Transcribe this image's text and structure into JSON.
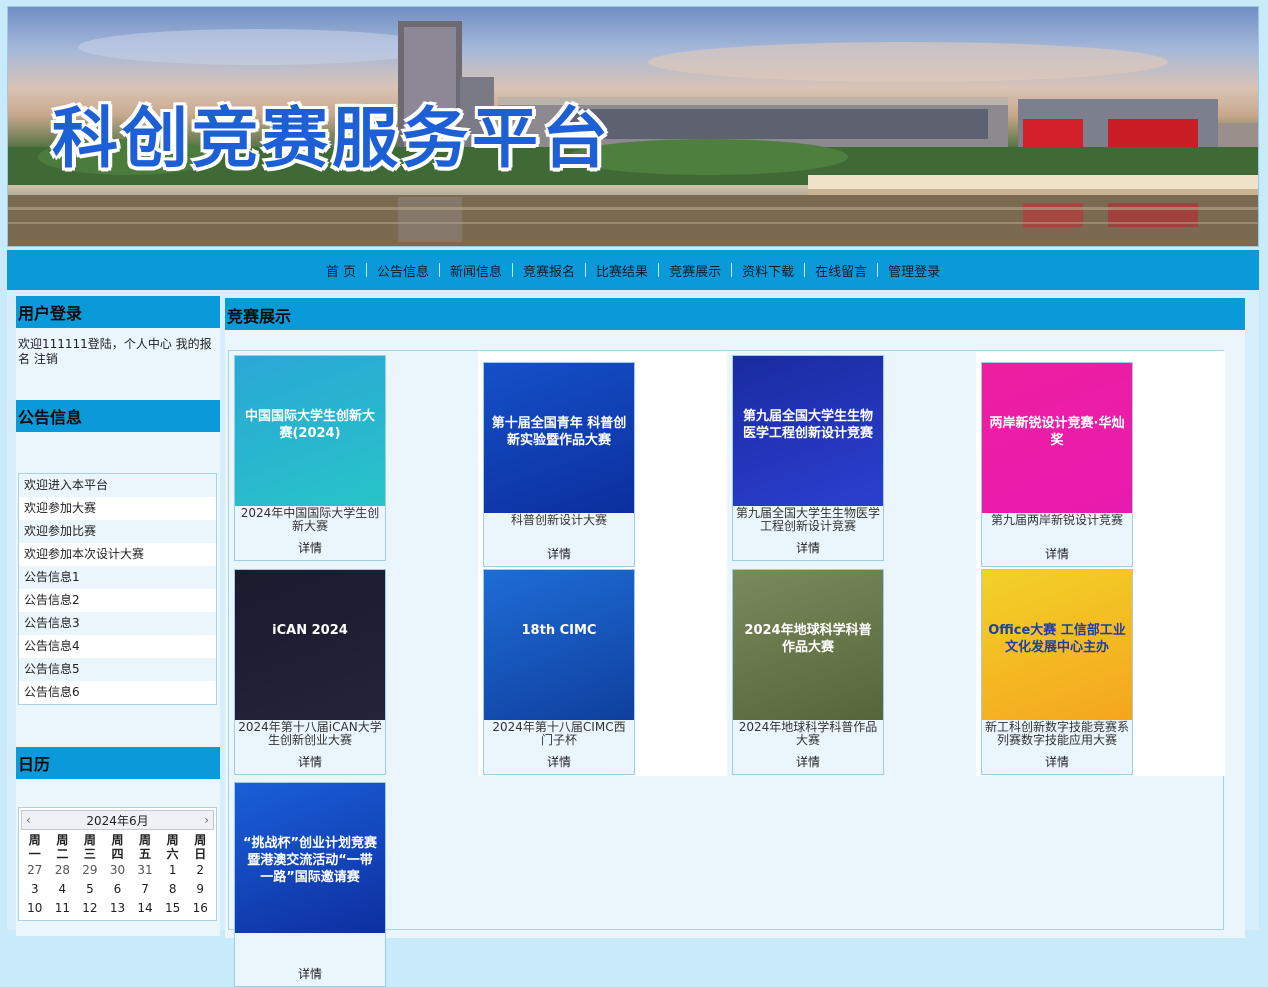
{
  "banner": {
    "title": "科创竞赛服务平台"
  },
  "nav": [
    "首 页",
    "公告信息",
    "新闻信息",
    "竞赛报名",
    "比赛结果",
    "竞赛展示",
    "资料下载",
    "在线留言",
    "管理登录"
  ],
  "sidebar": {
    "login_head": "用户登录",
    "login": {
      "welcome": "欢迎111111登陆，",
      "center": "个人中心",
      "myreg": "我的报名",
      "logout": "注销"
    },
    "notice_head": "公告信息",
    "notices": [
      "欢迎进入本平台",
      "欢迎参加大赛",
      "欢迎参加比赛",
      "欢迎参加本次设计大赛",
      "公告信息1",
      "公告信息2",
      "公告信息3",
      "公告信息4",
      "公告信息5",
      "公告信息6"
    ],
    "calendar_head": "日历",
    "calendar": {
      "month": "2024年6月",
      "prev": "‹",
      "next": "›",
      "weekdays": [
        "周一",
        "周二",
        "周三",
        "周四",
        "周五",
        "周六",
        "周日"
      ],
      "days": [
        "27",
        "28",
        "29",
        "30",
        "31",
        "1",
        "2",
        "3",
        "4",
        "5",
        "6",
        "7",
        "8",
        "9",
        "10",
        "11",
        "12",
        "13",
        "14",
        "15",
        "16"
      ]
    }
  },
  "main": {
    "title": "竞赛展示",
    "detail_label": "详情",
    "cards": [
      {
        "title": "2024年中国国际大学生创新大赛",
        "poster_text": "中国国际大学生创新大赛(2024)",
        "colors": [
          "#2aa7d6",
          "#27c4c8"
        ]
      },
      {
        "title": "科普创新设计大赛",
        "poster_text": "第十届全国青年 科普创新实验暨作品大赛",
        "colors": [
          "#1550c8",
          "#0b2f9e"
        ]
      },
      {
        "title": "第九届全国大学生生物医学工程创新设计竞赛",
        "poster_text": "第九届全国大学生生物医学工程创新设计竞赛",
        "colors": [
          "#1a2ba0",
          "#2b3fd0"
        ]
      },
      {
        "title": "第九届两岸新锐设计竞赛",
        "poster_text": "两岸新锐设计竞赛·华灿奖",
        "colors": [
          "#ee1ea0",
          "#e81bb0"
        ]
      },
      {
        "title": "2024年第十八届iCAN大学生创新创业大赛",
        "poster_text": "iCAN 2024",
        "colors": [
          "#1b1b2e",
          "#23233a"
        ]
      },
      {
        "title": "2024年第十八届CIMC西门子杯",
        "poster_text": "18th CIMC",
        "colors": [
          "#1e6dd6",
          "#0f3f9e"
        ]
      },
      {
        "title": "2024年地球科学科普作品大赛",
        "poster_text": "2024年地球科学科普作品大赛",
        "colors": [
          "#7a8a5c",
          "#55663a"
        ]
      },
      {
        "title": "新工科创新数字技能竞赛系列赛数字技能应用大赛",
        "poster_text": "Office大赛 工信部工业文化发展中心主办",
        "colors": [
          "#f2d22a",
          "#f5a51c"
        ]
      },
      {
        "title": "",
        "poster_text": "“挑战杯”创业计划竞赛 暨港澳交流活动“一带一路”国际邀请赛",
        "colors": [
          "#1a5fd8",
          "#0d2fa0"
        ]
      }
    ]
  },
  "colors": {
    "nav_bg": "#0b9ad9",
    "page_bg": "#c8eafa",
    "panel_bg": "#eaf5fc",
    "title_blue": "#1d5fd4"
  }
}
